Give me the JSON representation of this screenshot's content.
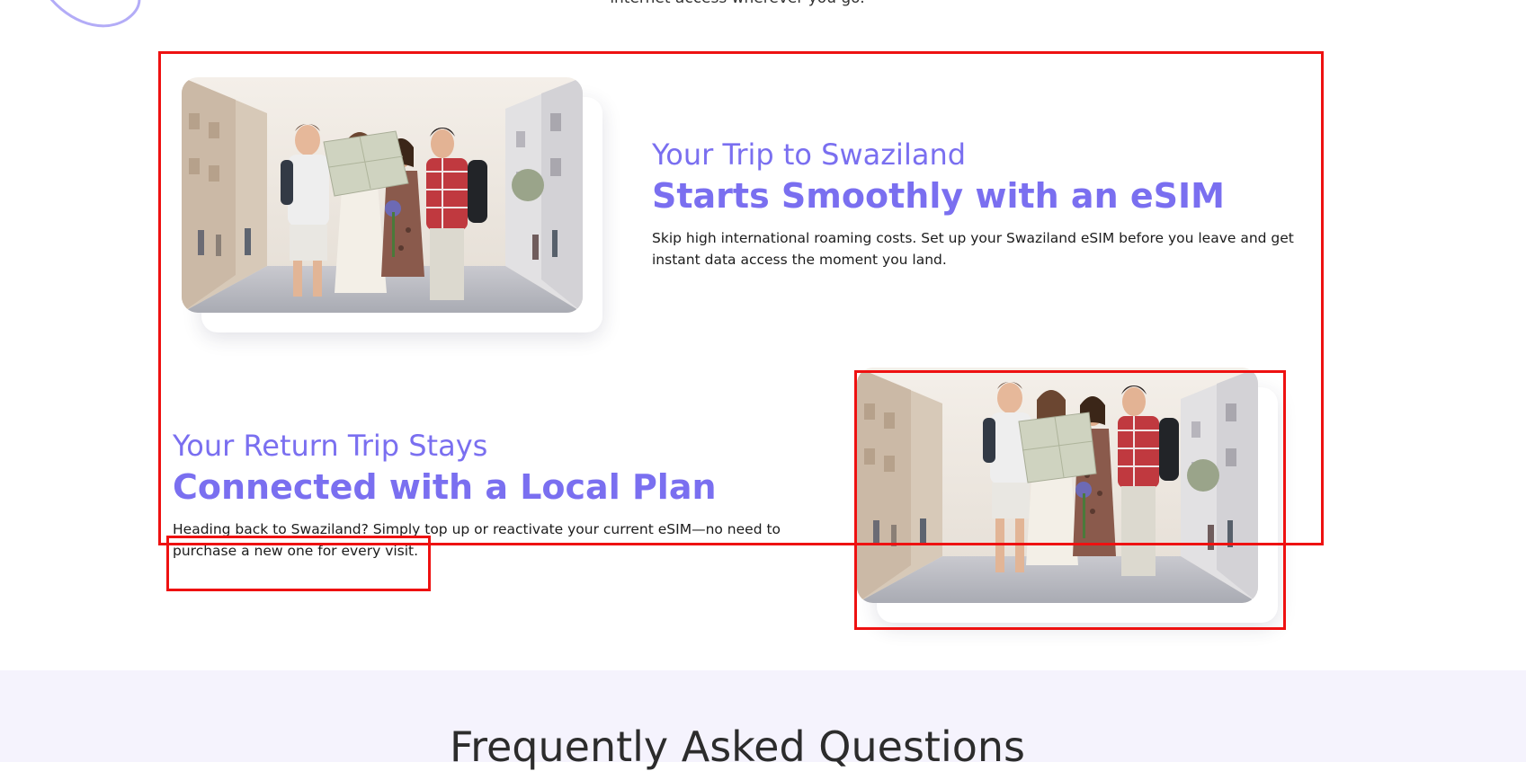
{
  "intro": {
    "tail_text": "internet access wherever you go."
  },
  "section1": {
    "sub_title": "Your Trip to Swaziland",
    "main_title": "Starts Smoothly with an eSIM",
    "description": "Skip high international roaming costs. Set up your Swaziland eSIM before you leave and get instant data access the moment you land."
  },
  "section2": {
    "sub_title": "Your Return Trip Stays",
    "main_title": "Connected with a Local Plan",
    "description": "Heading back to Swaziland? Simply top up or reactivate your current eSIM—no need to purchase a new one for every visit."
  },
  "faq": {
    "title": "Frequently Asked Questions"
  },
  "colors": {
    "accent": "#7a6ff0",
    "annotation": "#ee1111",
    "faq_background": "#f5f3fd"
  }
}
